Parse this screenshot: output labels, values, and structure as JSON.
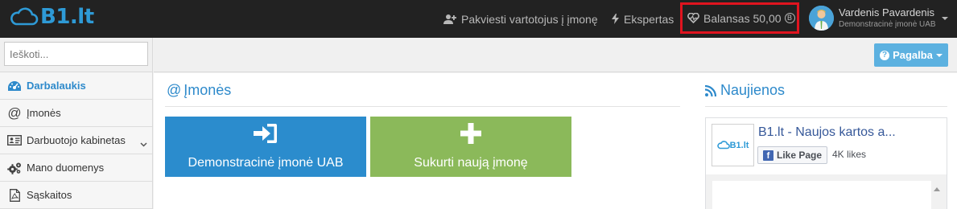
{
  "header": {
    "logo_text": "B1.lt",
    "invite_label": "Pakviesti vartotojus į įmonę",
    "expert_label": "Ekspertas",
    "balance_label": "Balansas 50,00",
    "balance_coin": "B",
    "user_name": "Vardenis Pavardenis",
    "user_company": "Demonstracinė įmonė UAB"
  },
  "sidebar": {
    "search_placeholder": "Ieškoti...",
    "items": [
      {
        "label": "Darbalaukis",
        "icon": "dashboard-icon",
        "active": true
      },
      {
        "label": "Įmonės",
        "icon": "at-icon"
      },
      {
        "label": "Darbuotojo kabinetas",
        "icon": "id-card-icon",
        "has_submenu": true
      },
      {
        "label": "Mano duomenys",
        "icon": "cogs-icon"
      },
      {
        "label": "Sąskaitos",
        "icon": "pdf-file-icon"
      }
    ]
  },
  "toolbar": {
    "help_label": "Pagalba"
  },
  "companies": {
    "title": "Įmonės",
    "tiles": [
      {
        "label": "Demonstracinė įmonė UAB",
        "icon": "sign-in-icon"
      },
      {
        "label": "Sukurti naują įmonę",
        "icon": "plus-icon"
      }
    ]
  },
  "news": {
    "title": "Naujienos",
    "fb_page_title": "B1.lt - Naujos kartos a...",
    "fb_logo_text": "B1.lt",
    "fb_like_label": "Like Page",
    "fb_likes": "4K likes"
  },
  "colors": {
    "topbar": "#222222",
    "accent": "#2e8acb",
    "tile_blue": "#2b8ccd",
    "tile_green": "#8bb95a",
    "highlight_border": "#e0141f",
    "help_button": "#5cb1e0"
  }
}
